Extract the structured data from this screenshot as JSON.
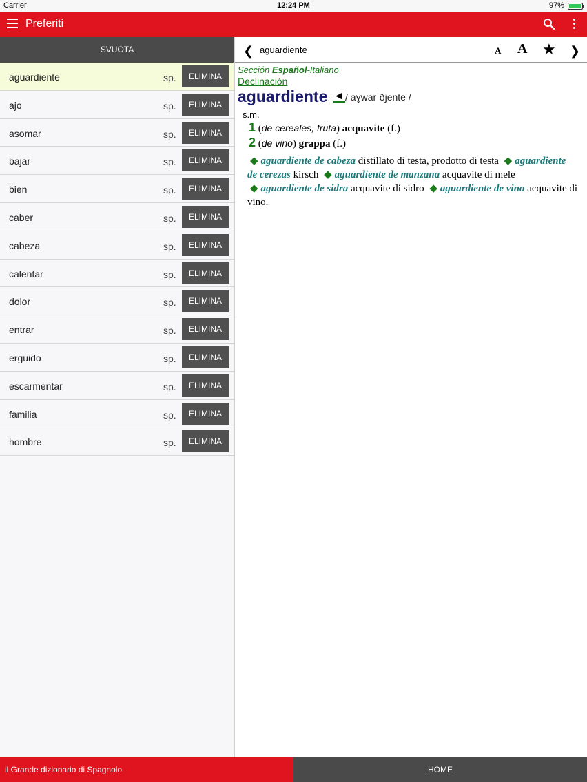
{
  "status": {
    "carrier": "Carrier",
    "time": "12:24 PM",
    "battery": "97%",
    "battery_level": 0.97
  },
  "appbar": {
    "title": "Preferiti",
    "menu_icon": "hamburger-icon",
    "search_icon": "search-icon",
    "more_icon": "more-vertical-icon"
  },
  "left": {
    "clear_label": "SVUOTA",
    "items": [
      {
        "word": "aguardiente",
        "pos": "sp.",
        "action": "ELIMINA",
        "selected": true
      },
      {
        "word": "ajo",
        "pos": "sp.",
        "action": "ELIMINA"
      },
      {
        "word": "asomar",
        "pos": "sp.",
        "action": "ELIMINA"
      },
      {
        "word": "bajar",
        "pos": "sp.",
        "action": "ELIMINA"
      },
      {
        "word": "bien",
        "pos": "sp.",
        "action": "ELIMINA"
      },
      {
        "word": "caber",
        "pos": "sp.",
        "action": "ELIMINA"
      },
      {
        "word": "cabeza",
        "pos": "sp.",
        "action": "ELIMINA"
      },
      {
        "word": "calentar",
        "pos": "sp.",
        "action": "ELIMINA"
      },
      {
        "word": "dolor",
        "pos": "sp.",
        "action": "ELIMINA"
      },
      {
        "word": "entrar",
        "pos": "sp.",
        "action": "ELIMINA"
      },
      {
        "word": "erguido",
        "pos": "sp.",
        "action": "ELIMINA"
      },
      {
        "word": "escarmentar",
        "pos": "sp.",
        "action": "ELIMINA"
      },
      {
        "word": "familia",
        "pos": "sp.",
        "action": "ELIMINA"
      },
      {
        "word": "hombre",
        "pos": "sp.",
        "action": "ELIMINA"
      }
    ]
  },
  "toolbar": {
    "headword": "aguardiente",
    "font_small": "A",
    "font_big": "A",
    "back_icon": "chevron-left-icon",
    "next_icon": "chevron-right-icon",
    "star_icon": "star-icon"
  },
  "entry": {
    "section_prefix": "Sección",
    "section_lang": "Español",
    "section_suffix": "-Italiano",
    "declension": "Declinación",
    "headword": "aguardiente",
    "pron": "/ aɣwarˈðjente /",
    "gram": "s.m.",
    "senses": [
      {
        "num": "1",
        "context": "de cereales, fruta",
        "translation": "acquavite",
        "gender": "(f.)"
      },
      {
        "num": "2",
        "context": "de vino",
        "translation": "grappa",
        "gender": "(f.)"
      }
    ],
    "examples": [
      {
        "phrase": "aguardiente de cabeza",
        "translation": "distillato di testa, prodotto di testa"
      },
      {
        "phrase": "aguardiente de cerezas",
        "translation": "kirsch"
      },
      {
        "phrase": "aguardiente de manzana",
        "translation": "acquavite di mele"
      },
      {
        "phrase": "aguardiente de sidra",
        "translation": "acquavite di sidro"
      },
      {
        "phrase": "aguardiente de vino",
        "translation": "acquavite di vino."
      }
    ]
  },
  "bottom": {
    "brand": "il Grande dizionario di Spagnolo",
    "home": "HOME"
  },
  "colors": {
    "brand_red": "#e0141e",
    "dark_gray": "#4a4a4a",
    "green": "#1a7a1a",
    "teal": "#1a7a7a",
    "navy": "#1a1a6e"
  }
}
